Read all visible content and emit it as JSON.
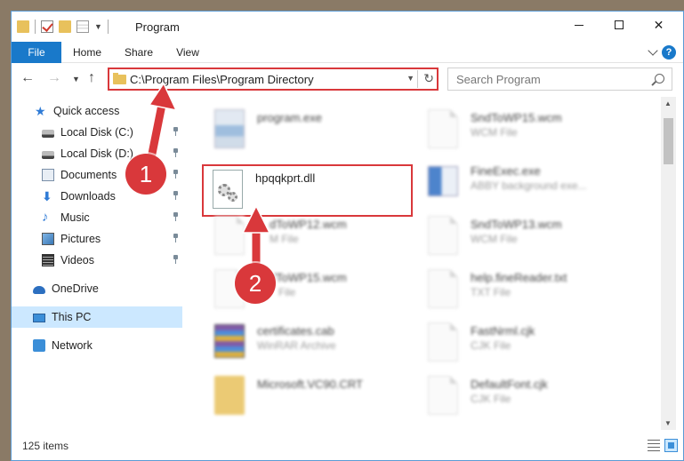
{
  "window": {
    "title": "Program",
    "controls": {
      "minimize": "minimize",
      "maximize": "maximize",
      "close": "✕"
    }
  },
  "ribbon": {
    "tabs": [
      "File",
      "Home",
      "Share",
      "View"
    ],
    "help": "?"
  },
  "nav": {
    "address": "C:\\Program Files\\Program Directory",
    "search_placeholder": "Search Program"
  },
  "sidebar": {
    "items": [
      {
        "label": "Quick access",
        "icon": "star-icon"
      },
      {
        "label": "Local Disk (C:)",
        "icon": "disk-icon",
        "pinned": true
      },
      {
        "label": "Local Disk (D:)",
        "icon": "disk-icon",
        "pinned": true
      },
      {
        "label": "Documents",
        "icon": "documents-icon",
        "pinned": true
      },
      {
        "label": "Downloads",
        "icon": "download-icon",
        "pinned": true
      },
      {
        "label": "Music",
        "icon": "music-icon",
        "pinned": true
      },
      {
        "label": "Pictures",
        "icon": "pictures-icon",
        "pinned": true
      },
      {
        "label": "Videos",
        "icon": "videos-icon",
        "pinned": true
      },
      {
        "label": "OneDrive",
        "icon": "cloud-icon"
      },
      {
        "label": "This PC",
        "icon": "computer-icon",
        "selected": true
      },
      {
        "label": "Network",
        "icon": "network-icon"
      }
    ]
  },
  "files": [
    {
      "name": "program.exe",
      "type": ""
    },
    {
      "name": "SndToWP15.wcm",
      "type": "WCM File"
    },
    {
      "name": "hpqqkprt.dll",
      "type": ""
    },
    {
      "name": "FineExec.exe",
      "type": "ABBY background exe..."
    },
    {
      "name": "dToWP12.wcm",
      "type": "M File"
    },
    {
      "name": "SndToWP13.wcm",
      "type": "WCM File"
    },
    {
      "name": "dToWP15.wcm",
      "type": "File"
    },
    {
      "name": "help.fineReader.txt",
      "type": "TXT File"
    },
    {
      "name": "certificates.cab",
      "type": "WinRAR Archive"
    },
    {
      "name": "FastNrml.cjk",
      "type": "CJK File"
    },
    {
      "name": "Microsoft.VC90.CRT",
      "type": ""
    },
    {
      "name": "DefaultFont.cjk",
      "type": "CJK File"
    }
  ],
  "status": {
    "items": "125 items"
  },
  "callouts": [
    "1",
    "2"
  ],
  "colors": {
    "accent": "#1979ca",
    "highlight": "#d9383b",
    "selected": "#cce8ff"
  }
}
